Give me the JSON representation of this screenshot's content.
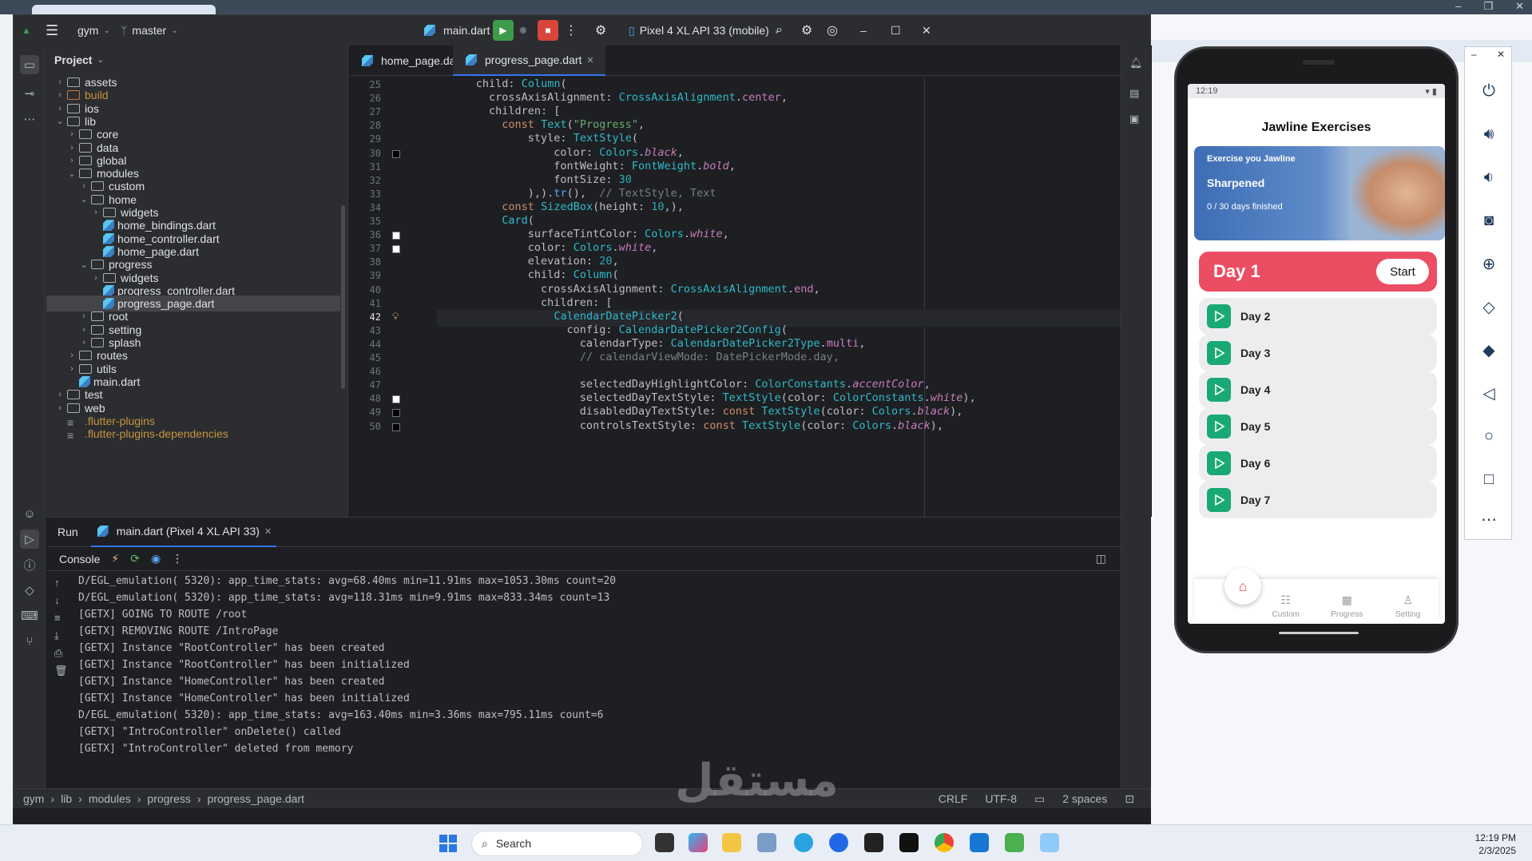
{
  "ide": {
    "project_name": "gym",
    "branch": "master",
    "run_config": "main.dart",
    "device": "Pixel 4 XL API 33 (mobile)",
    "tabs": [
      {
        "label": "home_page.dart"
      },
      {
        "label": "progress_page.dart"
      }
    ],
    "project_title": "Project",
    "tree": [
      {
        "label": "assets",
        "kind": "folder",
        "depth": 1,
        "arrow": "›"
      },
      {
        "label": "build",
        "kind": "folder-orange",
        "depth": 1,
        "arrow": "›"
      },
      {
        "label": "ios",
        "kind": "folder",
        "depth": 1,
        "arrow": "›"
      },
      {
        "label": "lib",
        "kind": "folder",
        "depth": 1,
        "arrow": "⌄"
      },
      {
        "label": "core",
        "kind": "folder",
        "depth": 2,
        "arrow": "›"
      },
      {
        "label": "data",
        "kind": "folder",
        "depth": 2,
        "arrow": "›"
      },
      {
        "label": "global",
        "kind": "folder",
        "depth": 2,
        "arrow": "›"
      },
      {
        "label": "modules",
        "kind": "folder",
        "depth": 2,
        "arrow": "⌄"
      },
      {
        "label": "custom",
        "kind": "folder",
        "depth": 3,
        "arrow": "›"
      },
      {
        "label": "home",
        "kind": "folder",
        "depth": 3,
        "arrow": "⌄"
      },
      {
        "label": "widgets",
        "kind": "folder",
        "depth": 4,
        "arrow": "›"
      },
      {
        "label": "home_bindings.dart",
        "kind": "dart",
        "depth": 4,
        "arrow": ""
      },
      {
        "label": "home_controller.dart",
        "kind": "dart",
        "depth": 4,
        "arrow": ""
      },
      {
        "label": "home_page.dart",
        "kind": "dart",
        "depth": 4,
        "arrow": ""
      },
      {
        "label": "progress",
        "kind": "folder",
        "depth": 3,
        "arrow": "⌄"
      },
      {
        "label": "widgets",
        "kind": "folder",
        "depth": 4,
        "arrow": "›"
      },
      {
        "label": "progress_controller.dart",
        "kind": "dart",
        "depth": 4,
        "arrow": ""
      },
      {
        "label": "progress_page.dart",
        "kind": "dart",
        "depth": 4,
        "arrow": "",
        "selected": true
      },
      {
        "label": "root",
        "kind": "folder",
        "depth": 3,
        "arrow": "›"
      },
      {
        "label": "setting",
        "kind": "folder",
        "depth": 3,
        "arrow": "›"
      },
      {
        "label": "splash",
        "kind": "folder",
        "depth": 3,
        "arrow": "›"
      },
      {
        "label": "routes",
        "kind": "folder",
        "depth": 2,
        "arrow": "›"
      },
      {
        "label": "utils",
        "kind": "folder",
        "depth": 2,
        "arrow": "›"
      },
      {
        "label": "main.dart",
        "kind": "dart",
        "depth": 2,
        "arrow": ""
      },
      {
        "label": "test",
        "kind": "folder",
        "depth": 1,
        "arrow": "›"
      },
      {
        "label": "web",
        "kind": "folder",
        "depth": 1,
        "arrow": "›"
      },
      {
        "label": ".flutter-plugins",
        "kind": "file-orange",
        "depth": 1,
        "arrow": ""
      },
      {
        "label": ".flutter-plugins-dependencies",
        "kind": "file-orange",
        "depth": 1,
        "arrow": ""
      }
    ],
    "code": [
      {
        "n": "25",
        "html": "<span class='cm'>      </span>child: <span class='cls'>Column</span>("
      },
      {
        "n": "26",
        "html": "        crossAxisAlignment: <span class='cls'>CrossAxisAlignment</span>.<span class='prop'>center</span>,"
      },
      {
        "n": "27",
        "html": "        children: ["
      },
      {
        "n": "28",
        "html": "          <span class='kw'>const</span> <span class='cls'>Text</span>(<span class='str'>\"Progress\"</span>,"
      },
      {
        "n": "29",
        "html": "              style: <span class='cls'>TextStyle</span>("
      },
      {
        "n": "30",
        "html": "                  color: <span class='cls'>Colors</span>.<span class='prop it'>black</span>,",
        "sw": "#000000"
      },
      {
        "n": "31",
        "html": "                  fontWeight: <span class='cls'>FontWeight</span>.<span class='prop it'>bold</span>,"
      },
      {
        "n": "32",
        "html": "                  fontSize: <span class='num'>30</span>"
      },
      {
        "n": "33",
        "html": "              ),).<span class='fn'>tr</span>(),  <span class='cm'>// TextStyle, Text</span>"
      },
      {
        "n": "34",
        "html": "          <span class='kw'>const</span> <span class='cls'>SizedBox</span>(height: <span class='num'>10</span>,),"
      },
      {
        "n": "35",
        "html": "          <span class='cls'>Card</span>("
      },
      {
        "n": "36",
        "html": "              surfaceTintColor: <span class='cls'>Colors</span>.<span class='prop it'>white</span>,",
        "sw": "#ffffff"
      },
      {
        "n": "37",
        "html": "              color: <span class='cls'>Colors</span>.<span class='prop it'>white</span>,",
        "sw": "#ffffff"
      },
      {
        "n": "38",
        "html": "              elevation: <span class='num'>20</span>,"
      },
      {
        "n": "39",
        "html": "              child: <span class='cls'>Column</span>("
      },
      {
        "n": "40",
        "html": "                crossAxisAlignment: <span class='cls'>CrossAxisAlignment</span>.<span class='prop'>end</span>,"
      },
      {
        "n": "41",
        "html": "                children: ["
      },
      {
        "n": "42",
        "html": "                  <span class='cls'>CalendarDatePicker2</span>(",
        "cur": true
      },
      {
        "n": "43",
        "html": "                    config: <span class='cls'>CalendarDatePicker2Config</span>("
      },
      {
        "n": "44",
        "html": "                      calendarType: <span class='cls'>CalendarDatePicker2Type</span>.<span class='prop'>multi</span>,"
      },
      {
        "n": "45",
        "html": "                      <span class='cm'>// calendarViewMode: DatePickerMode.day,</span>"
      },
      {
        "n": "46",
        "html": ""
      },
      {
        "n": "47",
        "html": "                      selectedDayHighlightColor: <span class='cls'>ColorConstants</span>.<span class='prop it'>accentColor</span>,"
      },
      {
        "n": "48",
        "html": "                      selectedDayTextStyle: <span class='cls'>TextStyle</span>(color: <span class='cls'>ColorConstants</span>.<span class='prop it'>white</span>),",
        "sw": "#ffffff"
      },
      {
        "n": "49",
        "html": "                      disabledDayTextStyle: <span class='kw'>const</span> <span class='cls'>TextStyle</span>(color: <span class='cls'>Colors</span>.<span class='prop it'>black</span>),",
        "sw": "#000000"
      },
      {
        "n": "50",
        "html": "                      controlsTextStyle: <span class='kw'>const</span> <span class='cls'>TextStyle</span>(color: <span class='cls'>Colors</span>.<span class='prop it'>black</span>),",
        "sw": "#000000"
      }
    ],
    "run_label": "Run",
    "run_tab": "main.dart (Pixel 4 XL API 33)",
    "console_label": "Console",
    "console": [
      "D/EGL_emulation( 5320): app_time_stats: avg=68.40ms min=11.91ms max=1053.30ms count=20",
      "D/EGL_emulation( 5320): app_time_stats: avg=118.31ms min=9.91ms max=833.34ms count=13",
      "[GETX] GOING TO ROUTE /root",
      "[GETX] REMOVING ROUTE /IntroPage",
      "[GETX] Instance \"RootController\" has been created",
      "[GETX] Instance \"RootController\" has been initialized",
      "[GETX] Instance \"HomeController\" has been created",
      "[GETX] Instance \"HomeController\" has been initialized",
      "D/EGL_emulation( 5320): app_time_stats: avg=163.40ms min=3.36ms max=795.11ms count=6",
      "[GETX] \"IntroController\" onDelete() called",
      "[GETX] \"IntroController\" deleted from memory"
    ],
    "breadcrumb": [
      "gym",
      "lib",
      "modules",
      "progress",
      "progress_page.dart"
    ],
    "status": {
      "line_ending": "CRLF",
      "encoding": "UTF-8",
      "indent": "2 spaces"
    }
  },
  "phone": {
    "time": "12:19",
    "title": "Jawline Exercises",
    "banner": {
      "line1": "Exercise you Jawline",
      "line2": "Sharpened",
      "line3": "0 / 30 days finished"
    },
    "day1": {
      "label": "Day 1",
      "button": "Start"
    },
    "days": [
      "Day 2",
      "Day 3",
      "Day 4",
      "Day 5",
      "Day 6",
      "Day 7"
    ],
    "nav": [
      "Custom",
      "Progress",
      "Setting"
    ]
  },
  "taskbar": {
    "search_placeholder": "Search",
    "time": "12:19 PM",
    "date": "2/3/2025"
  },
  "watermark": "مستقل",
  "colors": {
    "accent": "#3574f0",
    "day_active": "#eb4d63",
    "play": "#19a974",
    "run_green": "#3d9b4a",
    "stop_red": "#d9453b"
  }
}
